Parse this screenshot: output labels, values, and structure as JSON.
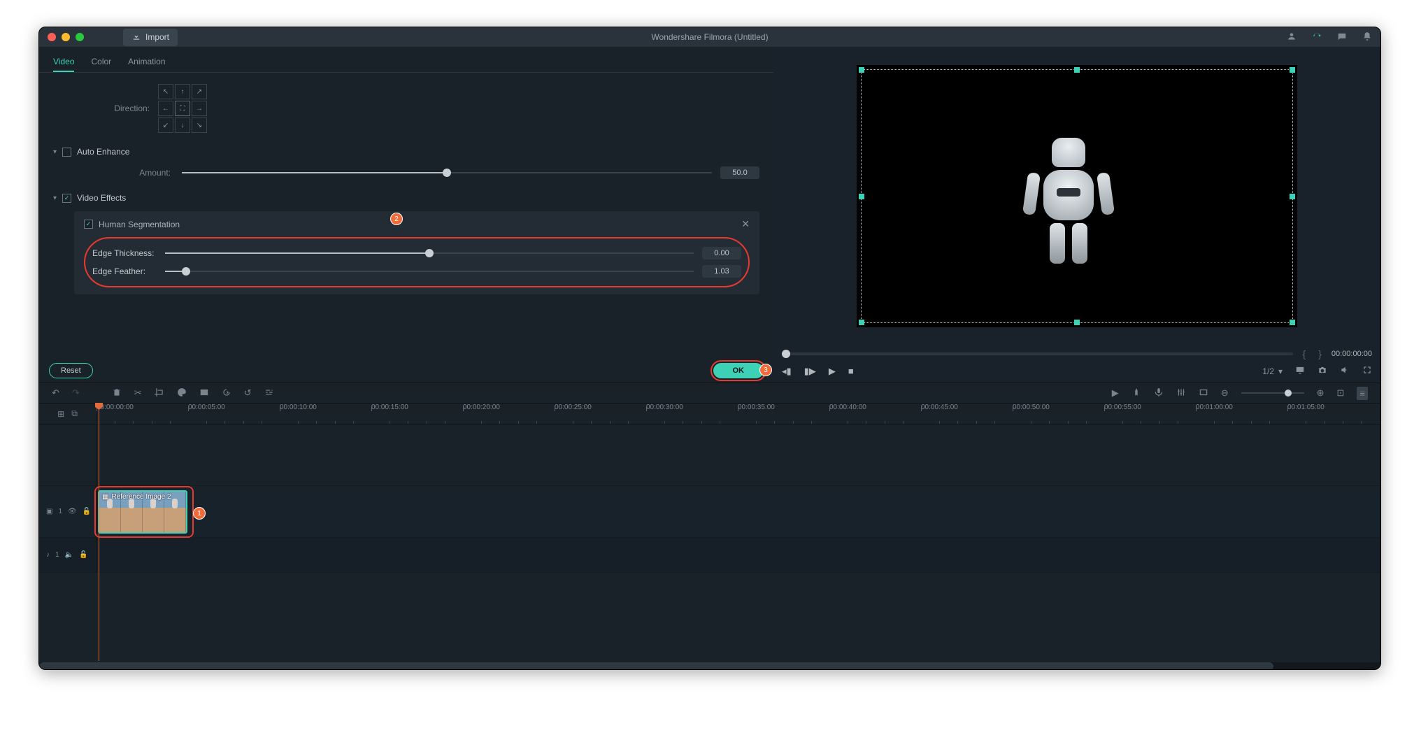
{
  "title": "Wondershare Filmora (Untitled)",
  "import_label": "Import",
  "tabs": {
    "video": "Video",
    "color": "Color",
    "animation": "Animation"
  },
  "direction_label": "Direction:",
  "auto_enhance": {
    "title": "Auto Enhance",
    "amount_label": "Amount:",
    "amount_value": "50.0"
  },
  "video_effects": {
    "title": "Video Effects",
    "human_seg": "Human Segmentation",
    "edge_thickness_label": "Edge Thickness:",
    "edge_thickness_value": "0.00",
    "edge_feather_label": "Edge Feather:",
    "edge_feather_value": "1.03"
  },
  "reset_label": "Reset",
  "ok_label": "OK",
  "badges": {
    "one": "1",
    "two": "2",
    "three": "3"
  },
  "preview": {
    "timecode": "00:00:00:00",
    "zoom": "1/2"
  },
  "ruler": [
    "00:00:00:00",
    "00:00:05:00",
    "00:00:10:00",
    "00:00:15:00",
    "00:00:20:00",
    "00:00:25:00",
    "00:00:30:00",
    "00:00:35:00",
    "00:00:40:00",
    "00:00:45:00",
    "00:00:50:00",
    "00:00:55:00",
    "00:01:00:00",
    "00:01:05:00"
  ],
  "clip": {
    "label": "Reference Image 2"
  },
  "tracks": {
    "video_id": "1",
    "audio_id": "1"
  }
}
